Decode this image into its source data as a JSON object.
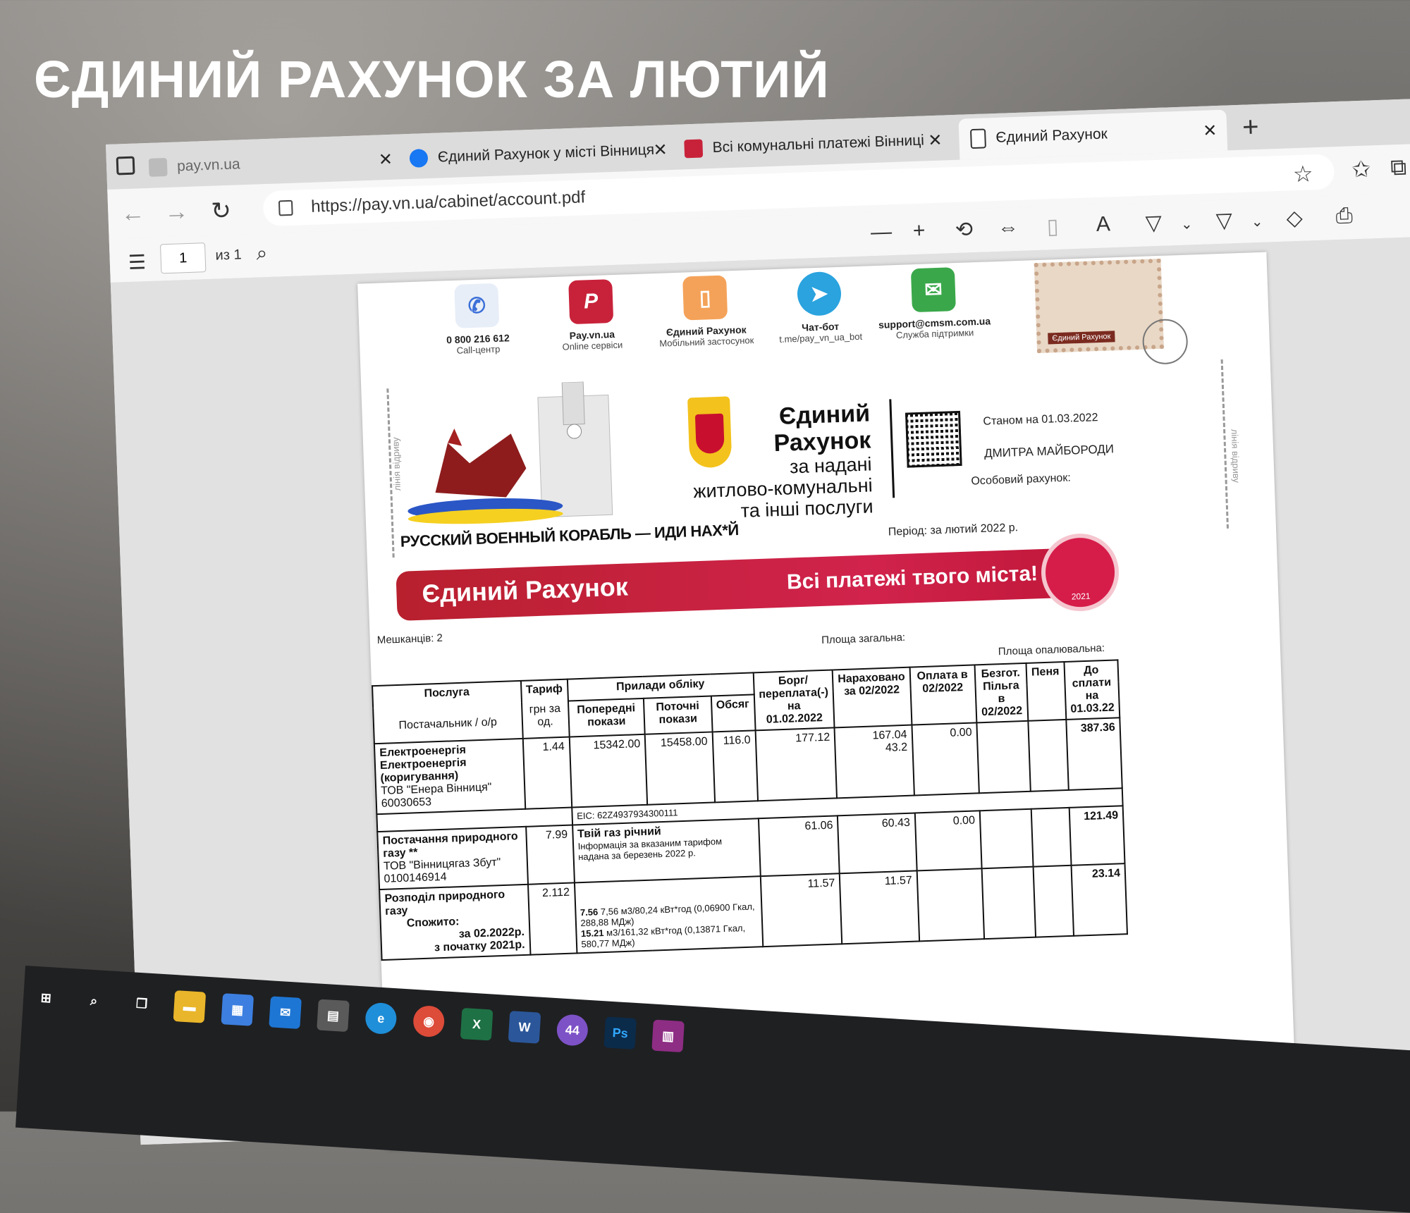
{
  "headline": "ЄДИНИЙ РАХУНОК ЗА ЛЮТИЙ",
  "tabs": [
    {
      "label": "pay.vn.ua",
      "active": false
    },
    {
      "label": "Єдиний Рахунок у місті Вінниця",
      "active": false
    },
    {
      "label": "Всі комунальні платежі Вінниці",
      "active": false
    },
    {
      "label": "Єдиний Рахунок",
      "active": true
    }
  ],
  "address": {
    "url": "https://pay.vn.ua/cabinet/account.pdf"
  },
  "pdf_toolbar": {
    "page": "1",
    "page_of": "из 1"
  },
  "contacts": [
    {
      "title": "0 800 216 612",
      "sub": "Call-центр",
      "icon": "phone-icon",
      "color": "#3b6fd8"
    },
    {
      "title": "Pay.vn.ua",
      "sub": "Online сервіси",
      "icon": "pay-logo-icon",
      "color": "#c8223a"
    },
    {
      "title": "Єдиний Рахунок",
      "sub": "Мобільний застосунок",
      "icon": "mobile-app-icon",
      "color": "#ef8a2b"
    },
    {
      "title": "Чат-бот",
      "sub": "t.me/pay_vn_ua_bot",
      "icon": "telegram-icon",
      "color": "#2aa3df"
    },
    {
      "title": "support@cmsm.com.ua",
      "sub": "Служба підтримки",
      "icon": "mail-icon",
      "color": "#3aa84a"
    }
  ],
  "stamp_label": "Єдиний Рахунок",
  "slogan": "РУССКИЙ ВОЕННЫЙ КОРАБЛЬ — ИДИ НАХ*Й",
  "cut_label": "лінія відриву",
  "brand": {
    "line1": "Єдиний",
    "line2": "Рахунок",
    "line3": "за надані",
    "line4": "житлово-комунальні",
    "line5": "та інші послуги"
  },
  "info": {
    "as_of": "Станом на 01.03.2022",
    "name": "ДМИТРА МАЙБОРОДИ",
    "account": "Особовий рахунок:",
    "period": "Період: за лютий 2022 р."
  },
  "banner": {
    "left": "Єдиний Рахунок",
    "right": "Всі платежі твого міста!"
  },
  "seal_year": "2021",
  "residents": "Мешканців: 2",
  "area_total": "Площа загальна:",
  "area_heated": "Площа опалювальна:",
  "table": {
    "headers": {
      "service": "Послуга",
      "supplier": "Постачальник / о/р",
      "tariff": "Тариф",
      "tariff_unit": "грн за од.",
      "meters": "Прилади обліку",
      "prev": "Попередні покази",
      "curr": "Поточні покази",
      "volume": "Обсяг",
      "debt": "Борг/ переплата(-) на 01.02.2022",
      "charged": "Нараховано за 02/2022",
      "paid": "Оплата в 02/2022",
      "benefit": "Безгот. Пільга в 02/2022",
      "penalty": "Пеня",
      "due": "До сплати на 01.03.22"
    },
    "rows": [
      {
        "service": "Електроенергія",
        "service2": "Електроенергія (коригування)",
        "supplier": "ТОВ \"Енера Вінниця\" 60030653",
        "tariff": "1.44",
        "prev": "15342.00",
        "curr": "15458.00",
        "volume": "116.0",
        "debt": "177.12",
        "charged": "167.04",
        "charged2": "43.2",
        "paid": "0.00",
        "eic": "EIC: 62Z4937934300111",
        "due": "387.36"
      },
      {
        "service": "Постачання природного газу **",
        "supplier": "ТОВ \"Вінницягаз Збут\" 0100146914",
        "tariff": "7.99",
        "note1": "Твій газ річний",
        "note2": "Інформація за вказаним тарифом надана за березень 2022 р.",
        "debt": "61.06",
        "charged": "60.43",
        "paid": "0.00",
        "due": "121.49"
      },
      {
        "service": "Розподіл природного газу",
        "consumed": "Спожито:",
        "for_period": "за 02.2022р.",
        "since": "з початку 2021р.",
        "tariff": "2.112",
        "debt": "11.57",
        "charged": "11.57",
        "vol1": "7.56",
        "vol1_desc": "7,56 м3/80,24 кВт*год (0,06900 Гкал, 288,88 МДж)",
        "vol2": "15.21",
        "vol2_desc": "м3/161,32 кВт*год (0,13871 Гкал, 580,77 МДж)",
        "due": "23.14"
      }
    ]
  },
  "taskbar": [
    {
      "name": "start-icon",
      "label": "⊞",
      "color": "#1f2022"
    },
    {
      "name": "search-icon",
      "label": "⌕",
      "color": "#1f2022"
    },
    {
      "name": "task-view-icon",
      "label": "❐",
      "color": "#1f2022"
    },
    {
      "name": "file-explorer-icon",
      "label": "▬",
      "color": "#e9b52a"
    },
    {
      "name": "store-icon",
      "label": "▦",
      "color": "#3d7fe0"
    },
    {
      "name": "mail-app-icon",
      "label": "✉",
      "color": "#1e76d4"
    },
    {
      "name": "calculator-icon",
      "label": "▤",
      "color": "#5a5a5a"
    },
    {
      "name": "edge-icon",
      "label": "e",
      "color": "#1f8fd9"
    },
    {
      "name": "chrome-icon",
      "label": "◉",
      "color": "#dd4b39"
    },
    {
      "name": "excel-icon",
      "label": "X",
      "color": "#1e7145"
    },
    {
      "name": "word-icon",
      "label": "W",
      "color": "#2b579a"
    },
    {
      "name": "viber-icon",
      "label": "44",
      "color": "#7d52c7"
    },
    {
      "name": "photoshop-icon",
      "label": "Ps",
      "color": "#0b2b4a"
    },
    {
      "name": "winrar-icon",
      "label": "▥",
      "color": "#8e2d84"
    }
  ]
}
